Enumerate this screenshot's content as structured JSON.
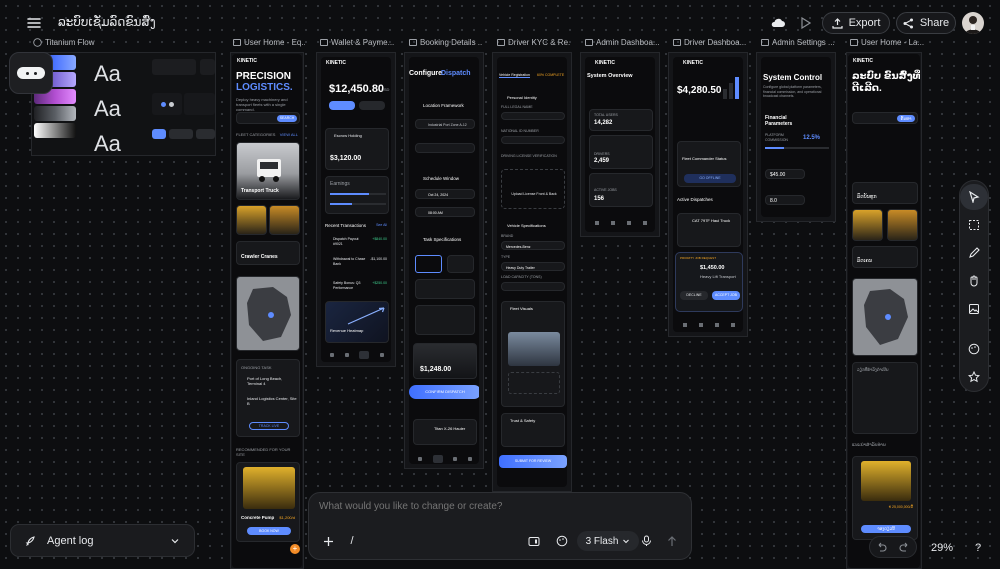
{
  "topbar": {
    "project_title": "ລະບົບເຊັ່ມລົດຂົນສົ່ງ",
    "export_label": "Export",
    "share_label": "Share"
  },
  "frames": [
    {
      "label": "Titanium Flow"
    },
    {
      "label": "User Home - Eq..."
    },
    {
      "label": "Wallet & Payme..."
    },
    {
      "label": "Booking Details ..."
    },
    {
      "label": "Driver KYC & Re..."
    },
    {
      "label": "Admin Dashboa..."
    },
    {
      "label": "Driver Dashboa..."
    },
    {
      "label": "Admin Settings ..."
    },
    {
      "label": "User Home - La..."
    }
  ],
  "design_system": {
    "aa": "Aa"
  },
  "user_home": {
    "brand": "KINETIC",
    "hero_line1": "PRECISION",
    "hero_line2": "LOGISTICS.",
    "hero_sub": "Deploy heavy machinery and transport fleets with a single command.",
    "search_btn": "SEARCH",
    "fleet_categories": "FLEET CATEGORIES",
    "view_all": "VIEW ALL",
    "transport_truck": "Transport Truck",
    "crawler_cranes": "Crawler Cranes",
    "ongoing_task": "ONGOING TASK",
    "task_1": "Port of Long Beach, Terminal 4",
    "task_2": "Inland Logistics Center, Site B",
    "track_live": "TRACK LIVE",
    "recommended": "RECOMMENDED FOR YOUR SITE",
    "concrete_pump": "Concrete Pump",
    "pump_price": "$1,200/d",
    "book_now": "BOOK NOW"
  },
  "wallet": {
    "brand": "KINETIC",
    "balance": "$12,450.80",
    "currency": "USD",
    "escrow_holding": "Escrow Holding",
    "escrow_amount": "$3,120.00",
    "earnings": "Earnings",
    "recent_transactions": "Recent Transactions",
    "see_all": "See All",
    "tx_1": "Dispatch Payout #9021",
    "tx_1_amt": "+$840.00",
    "tx_2": "Withdrawal to Chase Bank",
    "tx_2_amt": "-$1,100.00",
    "tx_3": "Safety Bonus: Q3 Performance",
    "tx_3_amt": "+$250.00",
    "heatmap": "Revenue Heatmap"
  },
  "booking": {
    "title_1": "Configure",
    "title_2": "Dispatch",
    "location": "Location Framework",
    "pickup": "Industrial Port Zone A-12",
    "schedule": "Schedule Window",
    "date": "Oct 24, 2024",
    "time": "08:00 AM",
    "task_specs": "Task Specifications",
    "estimate": "$1,248.00",
    "cta": "CONFIRM DISPATCH",
    "hauler": "Titan X-26 Hauler"
  },
  "kyc": {
    "tab_1": "Vehicle Registration",
    "tab_2": "60% COMPLETE",
    "personal_identity": "Personal Identity",
    "full_legal_name": "FULL LEGAL NAME",
    "national_id": "NATIONAL ID NUMBER",
    "driving_license": "DRIVING LICENSE VERIFICATION",
    "upload_license": "Upload License Front & Back",
    "vehicle_specs": "Vehicle Specifications",
    "brand_label": "BRAND",
    "brand_val": "Mercedes-Benz",
    "type_label": "TYPE",
    "type_val": "Heavy Duty Trailer",
    "load_capacity": "LOAD CAPACITY (TONS)",
    "fleet_visuals": "Fleet Visuals",
    "trust_safety": "Trust & Safety",
    "submit": "SUBMIT FOR REVIEW"
  },
  "admin_dash": {
    "brand": "KINETIC",
    "overview": "System Overview",
    "total_users": "TOTAL USERS",
    "users_val": "14,282",
    "total_drivers": "DRIVERS",
    "drivers_val": "2,459",
    "active_jobs": "ACTIVE JOBS",
    "jobs_val": "156"
  },
  "driver_dash": {
    "brand": "KINETIC",
    "earnings": "$4,280.50",
    "fleet_status": "Fleet Commander Status",
    "go_offline": "GO OFFLINE",
    "active_dispatches": "Active Dispatches",
    "cat_job": "CAT 797F Haul Truck",
    "priority": "PRIORITY JOB REQUEST",
    "job_price": "$1,450.00",
    "job_name": "Heavy Lift Transport",
    "decline": "DECLINE",
    "accept": "ACCEPT JOB"
  },
  "admin_settings": {
    "title": "System Control",
    "sub": "Configure global platform parameters, financial commission, and operational broadcast channels.",
    "financial": "Financial Parameters",
    "platform_commission": "PLATFORM COMMISSION",
    "commission_val": "12.5%",
    "base_fee": "$45.00",
    "rate": "8.0"
  },
  "lao_home": {
    "brand": "KINETIC",
    "hero": "ລະບົບ ຂົນສົ່ງທີ່ດີເລີດ.",
    "search_btn": "ຄົ້ນຫາ",
    "cat_1": "ລົດບັນທຸກ",
    "cat_2": "ລົດເຄນ",
    "ongoing": "ວຽກທີ່ກຳລັງດຳເນີນ",
    "recommended": "ແນະນຳສຳລັບທ່ານ",
    "price": "₭ 25,000,000/ມື້",
    "book": "ຈອງດຽວນີ້"
  },
  "chat": {
    "placeholder": "What would you like to change or create?",
    "slash": "/",
    "model": "3 Flash"
  },
  "agent_log": "Agent log",
  "zoom": "29%",
  "colors": {
    "accent": "#5e8cff",
    "canvas": "#0d0e10",
    "frame_bg": "#0b0b0d",
    "success": "#3ecf8e",
    "warning": "#f5a623"
  }
}
